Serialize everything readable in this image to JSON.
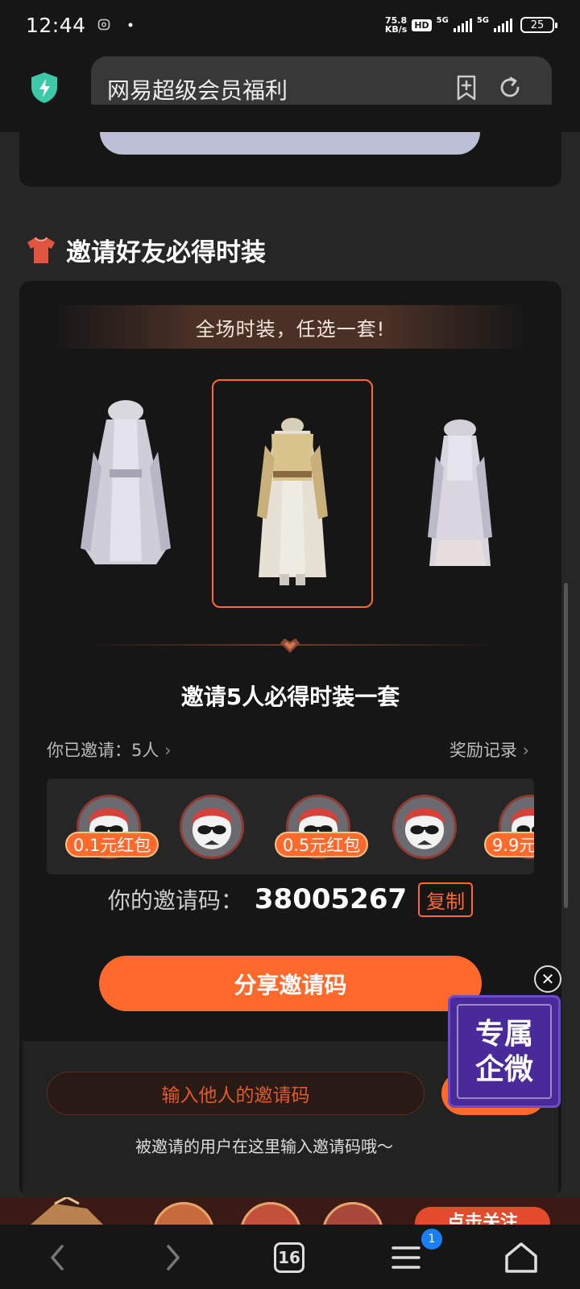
{
  "status_bar": {
    "time": "12:44",
    "net_speed_value": "75.8",
    "net_speed_unit": "KB/s",
    "hd_label": "HD",
    "signal_1_label": "5G",
    "signal_2_label": "5G",
    "battery": "25"
  },
  "address_bar": {
    "title": "网易超级会员福利",
    "icons": [
      "shield-bolt-icon",
      "bookmark-add-icon",
      "refresh-icon"
    ]
  },
  "section": {
    "title": "邀请好友必得时装",
    "icon": "shirt-icon"
  },
  "invite_card": {
    "banner": "全场时装，任选一套!",
    "outfits": [
      {
        "name": "outfit-left",
        "selected": false
      },
      {
        "name": "outfit-center",
        "selected": true
      },
      {
        "name": "outfit-right",
        "selected": false
      }
    ],
    "heading": "邀请5人必得时装一套",
    "invited_label": "你已邀请：5人",
    "reward_record_label": "奖励记录",
    "rewards": [
      {
        "tag": "0.1元红包"
      },
      {
        "tag": ""
      },
      {
        "tag": "0.5元红包"
      },
      {
        "tag": ""
      },
      {
        "tag": "9.9元"
      }
    ],
    "code_label": "你的邀请码：",
    "code_value": "38005267",
    "copy_label": "复制",
    "share_label": "分享邀请码",
    "enter_placeholder": "输入他人的邀请码",
    "enter_hint": "被邀请的用户在这里输入邀请码哦～"
  },
  "floating_widget": {
    "line1": "专属",
    "line2": "企微",
    "close_icon": "close-icon"
  },
  "promo_strip": {
    "follow_label": "点击关注"
  },
  "nav_bar": {
    "tab_count": "16",
    "menu_badge": "1"
  },
  "colors": {
    "accent": "#ff6a2c",
    "background": "#262626",
    "card": "#161616",
    "widget": "#4a2a9a"
  }
}
